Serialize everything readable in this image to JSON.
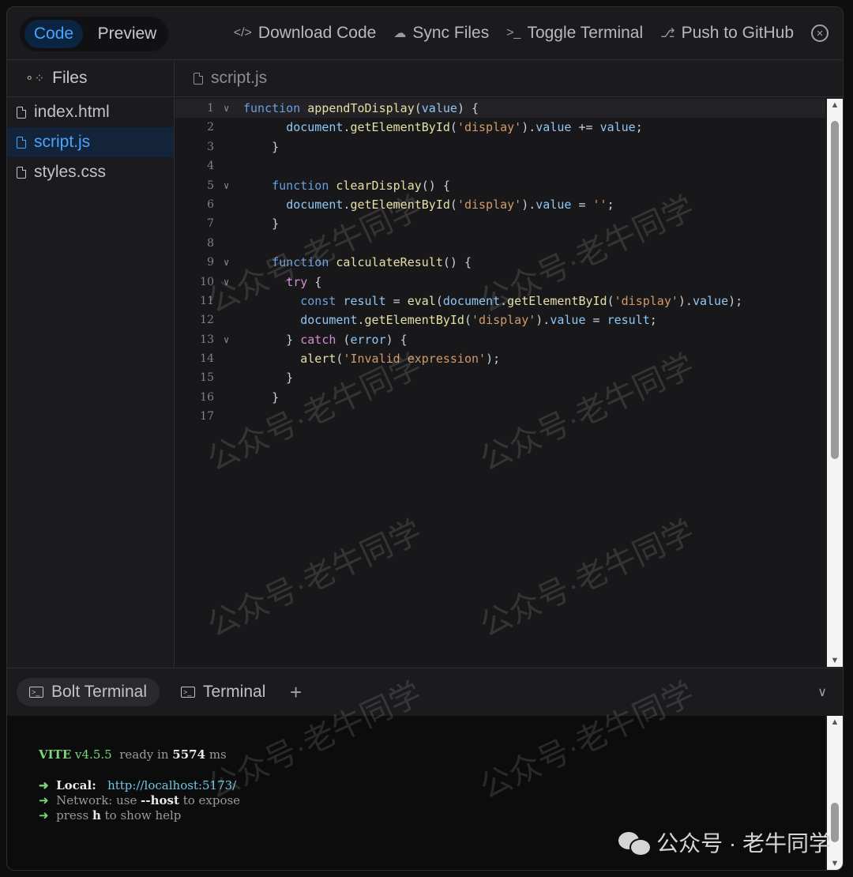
{
  "topbar": {
    "tabs": {
      "code": "Code",
      "preview": "Preview"
    },
    "actions": [
      {
        "icon": "</>",
        "label": "Download Code"
      },
      {
        "icon": "☁",
        "label": "Sync Files"
      },
      {
        "icon": ">_",
        "label": "Toggle Terminal"
      },
      {
        "icon": "⎇",
        "label": "Push to GitHub"
      }
    ],
    "close_icon": "×"
  },
  "sidebar": {
    "title": "Files",
    "files": [
      "index.html",
      "script.js",
      "styles.css"
    ],
    "active_index": 1
  },
  "editor": {
    "tab": "script.js",
    "lines": [
      {
        "n": "1",
        "fold": true,
        "code": "function appendToDisplay(value) {"
      },
      {
        "n": "2",
        "fold": false,
        "code": "      document.getElementById('display').value += value;"
      },
      {
        "n": "3",
        "fold": false,
        "code": "    }"
      },
      {
        "n": "4",
        "fold": false,
        "code": ""
      },
      {
        "n": "5",
        "fold": true,
        "code": "    function clearDisplay() {"
      },
      {
        "n": "6",
        "fold": false,
        "code": "      document.getElementById('display').value = '';"
      },
      {
        "n": "7",
        "fold": false,
        "code": "    }"
      },
      {
        "n": "8",
        "fold": false,
        "code": ""
      },
      {
        "n": "9",
        "fold": true,
        "code": "    function calculateResult() {"
      },
      {
        "n": "10",
        "fold": true,
        "code": "      try {"
      },
      {
        "n": "11",
        "fold": false,
        "code": "        const result = eval(document.getElementById('display').value);"
      },
      {
        "n": "12",
        "fold": false,
        "code": "        document.getElementById('display').value = result;"
      },
      {
        "n": "13",
        "fold": true,
        "code": "      } catch (error) {"
      },
      {
        "n": "14",
        "fold": false,
        "code": "        alert('Invalid expression');"
      },
      {
        "n": "15",
        "fold": false,
        "code": "      }"
      },
      {
        "n": "16",
        "fold": false,
        "code": "    }"
      },
      {
        "n": "17",
        "fold": false,
        "code": ""
      }
    ]
  },
  "terminal": {
    "tabs": [
      "Bolt Terminal",
      "Terminal"
    ],
    "add": "+",
    "collapse": "∨",
    "vite_name": "VITE",
    "vite_version": "v4.5.5",
    "ready_text": "ready in",
    "ready_ms": "5574",
    "ms_unit": "ms",
    "arrow": "➜",
    "local_label": "Local:",
    "local_url": "http://localhost:5173/",
    "network_label": "Network:",
    "network_use": "use",
    "network_flag": "--host",
    "network_tail": "to expose",
    "help_press": "press",
    "help_key": "h",
    "help_tail": "to show help"
  },
  "watermark": "公众号·老牛同学",
  "brand": "公众号 · 老牛同学"
}
